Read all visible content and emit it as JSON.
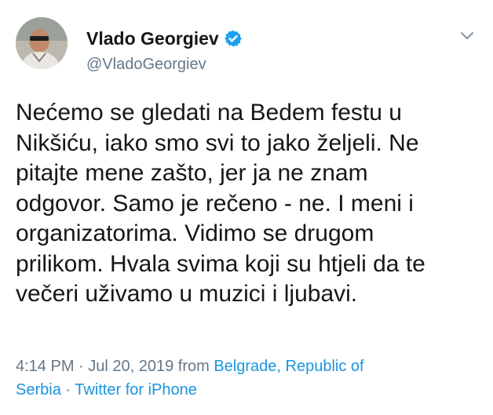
{
  "user": {
    "display_name": "Vlado Georgiev",
    "handle": "@VladoGeorgiev",
    "verified": true,
    "avatar_icon": "profile-photo"
  },
  "tweet": {
    "lines": [
      "Nećemo se gledati na Bedem festu u",
      "Nikšiću, iako smo svi to jako željeli. Ne",
      "pitajte mene zašto, jer ja ne znam",
      "odgovor. Samo je rečeno - ne. I meni i",
      "organizatorima. Vidimo se drugom",
      "prilikom. Hvala svima koji su htjeli da te",
      "večeri uživamo u muzici i ljubavi."
    ]
  },
  "meta": {
    "timestamp": "4:14 PM · Jul 20, 2019 from ",
    "location_line1": "Belgrade, Republic of",
    "location_line2": "Serbia",
    "separator": " · ",
    "source": "Twitter for iPhone"
  },
  "colors": {
    "text": "#14171a",
    "secondary": "#657786",
    "link": "#1b95e0",
    "verified": "#1da1f2"
  }
}
